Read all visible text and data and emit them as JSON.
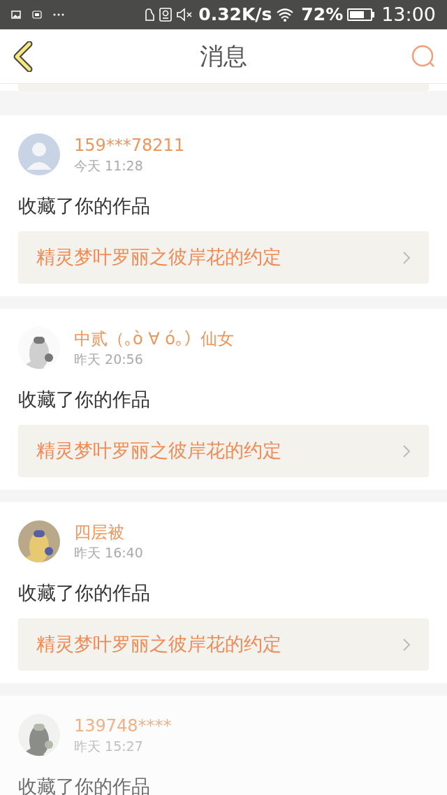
{
  "status_bar": {
    "network_speed": "0.32K/s",
    "battery_text": "72%",
    "time": "13:00"
  },
  "header": {
    "title": "消息"
  },
  "messages": [
    {
      "user": "159***78211",
      "time": "今天 11:28",
      "action": "收藏了你的作品",
      "work": "精灵梦叶罗丽之彼岸花的约定",
      "avatar": {
        "kind": "icon"
      },
      "faded": false
    },
    {
      "user": "中贰（｡ò ∀ ó｡）仙女",
      "time": "昨天 20:56",
      "action": "收藏了你的作品",
      "work": "精灵梦叶罗丽之彼岸花的约定",
      "faded": false
    },
    {
      "user": "四层被",
      "time": "昨天 16:40",
      "action": "收藏了你的作品",
      "work": "精灵梦叶罗丽之彼岸花的约定",
      "faded": false
    },
    {
      "user": "139748****",
      "time": "昨天 15:27",
      "action": "收藏了你的作品",
      "faded": true
    }
  ]
}
